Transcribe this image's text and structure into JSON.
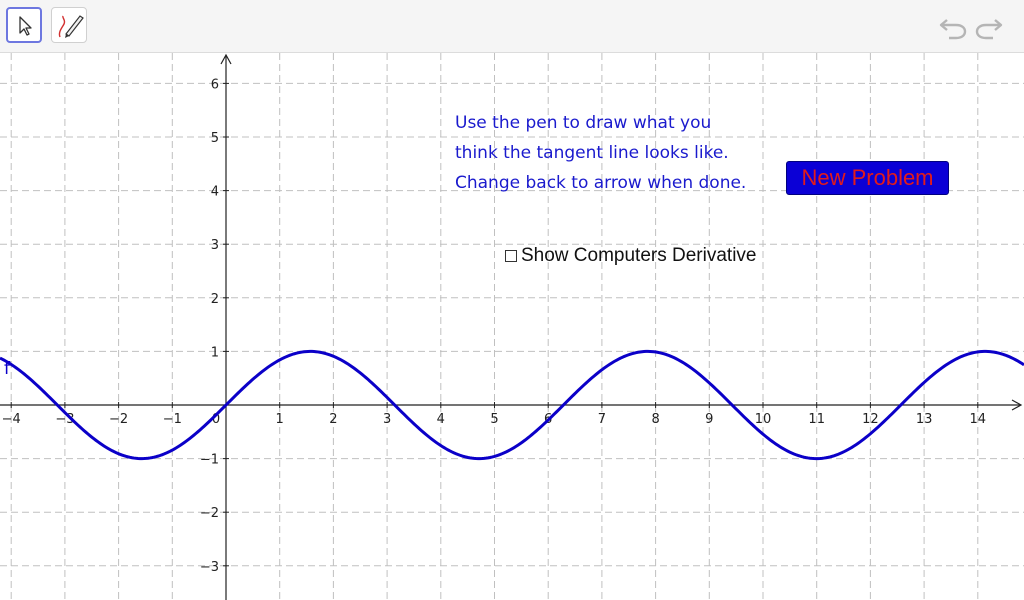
{
  "toolbar": {
    "tools": [
      {
        "name": "arrow-tool",
        "icon": "cursor-arrow-icon",
        "selected": true
      },
      {
        "name": "pen-tool",
        "icon": "pen-icon",
        "selected": false
      }
    ],
    "undo_icon": "undo-icon",
    "redo_icon": "redo-icon"
  },
  "graph": {
    "function_label": "f",
    "x_tick_labels": [
      "−4",
      "−3",
      "−2",
      "−1",
      "0",
      "1",
      "2",
      "3",
      "4",
      "5",
      "6",
      "7",
      "8",
      "9",
      "10",
      "11",
      "12",
      "13",
      "14"
    ],
    "y_tick_labels": [
      "−3",
      "−2",
      "−1",
      "1",
      "2",
      "3",
      "4",
      "5",
      "6"
    ],
    "curve_color": "#0b00c8",
    "grid_color": "#c0c0c0"
  },
  "instructions": {
    "line1": "Use the pen to draw what you",
    "line2": "think the tangent line looks like.",
    "line3": "Change back to arrow when done."
  },
  "new_problem_label": "New Problem",
  "checkbox": {
    "label": "Show Computers Derivative",
    "checked": false
  },
  "colors": {
    "button_bg": "#0b00d6",
    "button_text": "#e21b1b",
    "instruction_text": "#1a1acd"
  }
}
